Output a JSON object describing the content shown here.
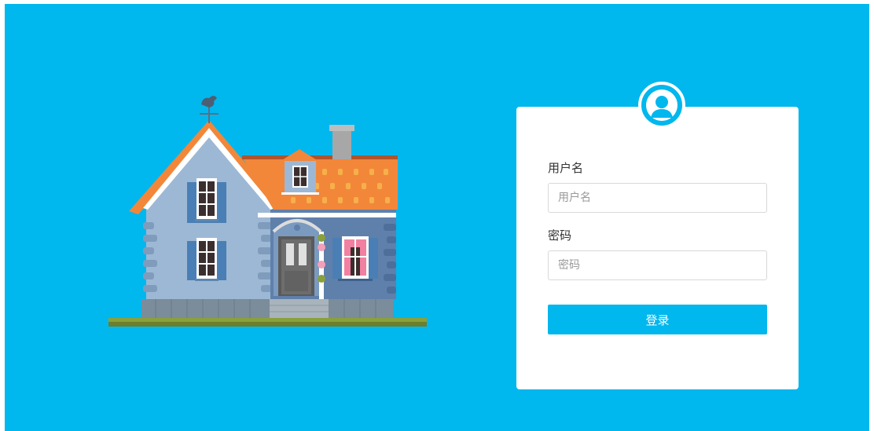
{
  "colors": {
    "background": "#00b7ee",
    "card": "#ffffff",
    "button": "#00b7ee",
    "button_text": "#ffffff"
  },
  "illustration": {
    "icon": "house-illustration"
  },
  "login_form": {
    "avatar_icon": "user-avatar-icon",
    "username_label": "用户名",
    "username_placeholder": "用户名",
    "username_value": "",
    "password_label": "密码",
    "password_placeholder": "密码",
    "password_value": "",
    "submit_label": "登录"
  }
}
